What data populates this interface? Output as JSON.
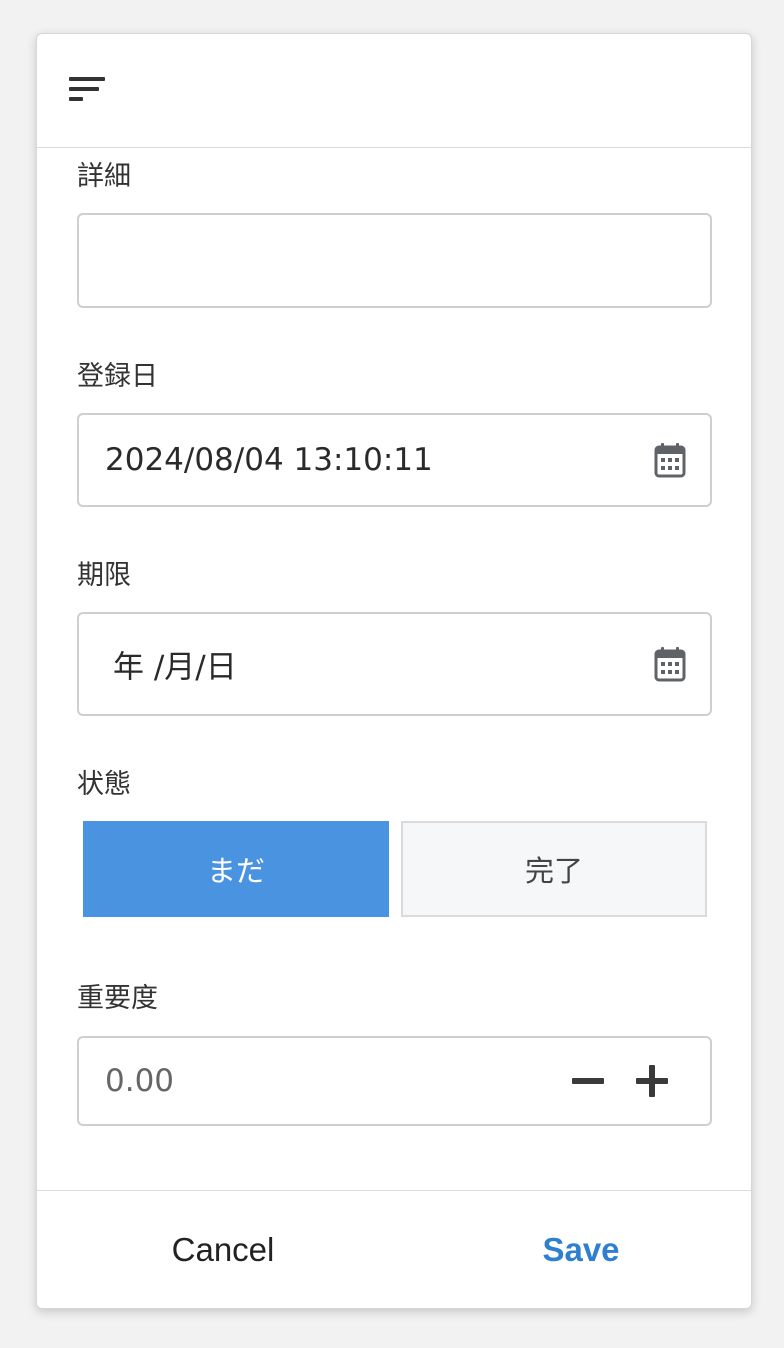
{
  "form": {
    "details": {
      "label": "詳細",
      "value": ""
    },
    "registered": {
      "label": "登録日",
      "value": "2024/08/04 13:10:11"
    },
    "deadline": {
      "label": "期限",
      "placeholder": "年 /月/日"
    },
    "status": {
      "label": "状態",
      "options": [
        "まだ",
        "完了"
      ],
      "selected": "まだ"
    },
    "priority": {
      "label": "重要度",
      "value": "0.00"
    }
  },
  "footer": {
    "cancel_label": "Cancel",
    "save_label": "Save"
  },
  "colors": {
    "accent": "#4993e0",
    "save_text": "#2f7fd0"
  },
  "icons": {
    "menu": "sort-lines-icon",
    "calendar": "calendar-icon",
    "minus": "minus-icon",
    "plus": "plus-icon"
  }
}
